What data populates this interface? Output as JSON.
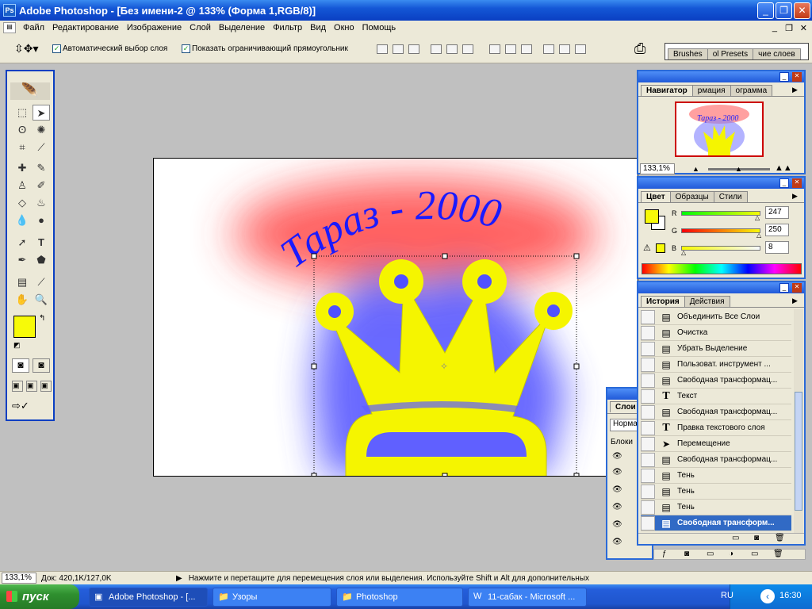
{
  "window": {
    "title": "Adobe Photoshop - [Без имени-2 @ 133% (Форма 1,RGB/8)]"
  },
  "menu": [
    "Файл",
    "Редактирование",
    "Изображение",
    "Слой",
    "Выделение",
    "Фильтр",
    "Вид",
    "Окно",
    "Помощь"
  ],
  "options": {
    "auto_select_label": "Автоматический выбор слоя",
    "show_bounds_label": "Показать ограничивающий прямоугольник",
    "palette_tabs": [
      "Brushes",
      "ol Presets",
      "чие слоев"
    ]
  },
  "canvas": {
    "title_text": "Тараз - 2000"
  },
  "navigator": {
    "tabs": [
      "Навигатор",
      "рмация",
      "ограмма"
    ],
    "thumb_text": "Тараз - 2000",
    "zoom": "133,1%"
  },
  "color_panel": {
    "tabs": [
      "Цвет",
      "Образцы",
      "Стили"
    ],
    "r_label": "R",
    "g_label": "G",
    "b_label": "B",
    "r": "247",
    "g": "250",
    "b": "8",
    "fg": "#f7fa08"
  },
  "history": {
    "tabs": [
      "История",
      "Действия"
    ],
    "items": [
      {
        "label": "Объединить Все Слои",
        "icon": "doc"
      },
      {
        "label": "Очистка",
        "icon": "doc"
      },
      {
        "label": "Убрать Выделение",
        "icon": "doc"
      },
      {
        "label": "Пользоват. инструмент ...",
        "icon": "doc"
      },
      {
        "label": "Свободная трансформац...",
        "icon": "doc"
      },
      {
        "label": "Текст",
        "icon": "T"
      },
      {
        "label": "Свободная трансформац...",
        "icon": "doc"
      },
      {
        "label": "Правка текстового слоя",
        "icon": "T"
      },
      {
        "label": "Перемещение",
        "icon": "move"
      },
      {
        "label": "Свободная трансформац...",
        "icon": "doc"
      },
      {
        "label": "Тень",
        "icon": "doc"
      },
      {
        "label": "Тень",
        "icon": "doc"
      },
      {
        "label": "Тень",
        "icon": "doc"
      },
      {
        "label": "Свободная трансформ...",
        "icon": "doc",
        "selected": true
      }
    ]
  },
  "layers": {
    "tab": "Слои",
    "mode": "Норма",
    "lock": "Блоки"
  },
  "status": {
    "zoom": "133,1%",
    "doc": "Док: 420,1K/127,0K",
    "hint": "Нажмите и перетащите для перемещения слоя или выделения. Используйте Shift и Alt для дополнительных"
  },
  "taskbar": {
    "start": "пуск",
    "tasks": [
      "Adobe Photoshop - [...",
      "Узоры",
      "Photoshop",
      "11-сабак - Microsoft ..."
    ],
    "lang": "RU",
    "time": "16:30"
  },
  "colors": {
    "crown": "#f5f500",
    "text": "#1a1aff",
    "glow_red": "#ff3030",
    "glow_blue": "#4848ff"
  }
}
